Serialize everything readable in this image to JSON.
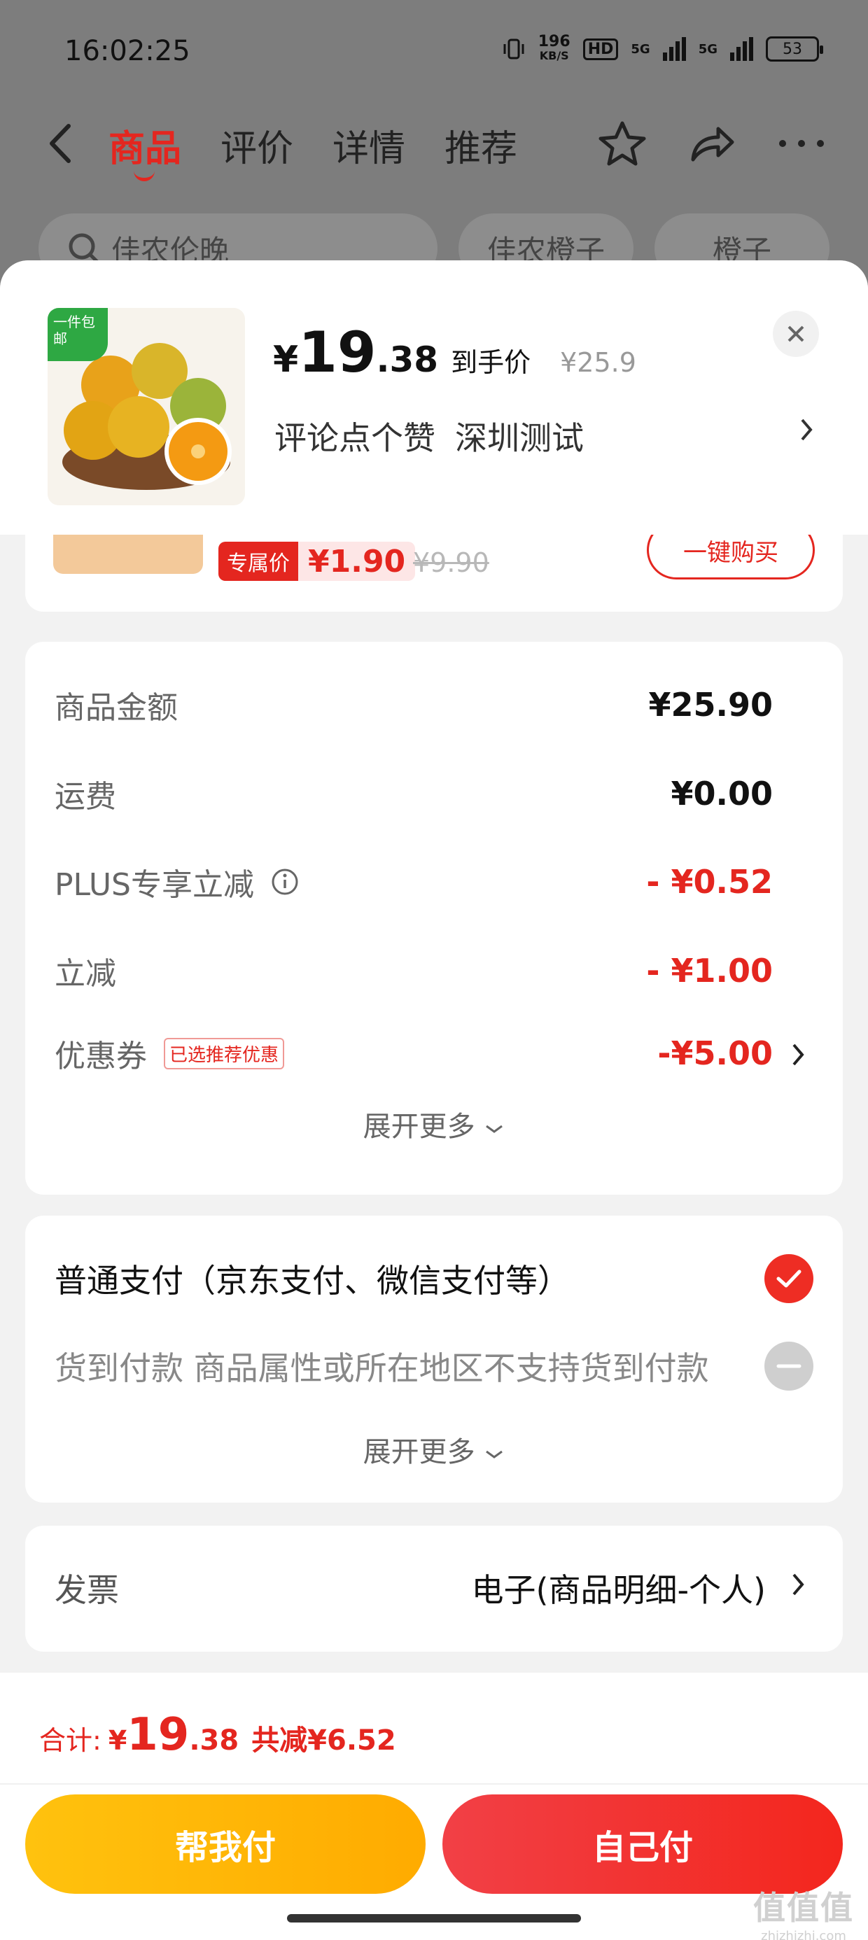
{
  "status_bar": {
    "time": "16:02:25",
    "net_speed_value": "196",
    "net_speed_unit": "KB/S",
    "hd": "HD",
    "sig1": "5G",
    "sig2": "5G",
    "battery": "53"
  },
  "nav": {
    "tabs": [
      "商品",
      "评价",
      "详情",
      "推荐"
    ],
    "active_tab": "商品",
    "icons": [
      "back-icon",
      "star-icon",
      "share-icon",
      "more-icon"
    ]
  },
  "background_search": {
    "search_text": "佳农伦晚",
    "chips": [
      "佳农橙子",
      "橙子"
    ]
  },
  "product": {
    "tag": "一件包邮",
    "price_currency": "¥",
    "price_int": "19",
    "price_dec": ".38",
    "price_label": "到手价",
    "original_price": "¥25.9",
    "spec_1": "评论点个赞",
    "spec_2": "深圳测试"
  },
  "upsell": {
    "badge": "专属价",
    "price": "¥1.90",
    "original": "¥9.90",
    "buy_label": "一键购买"
  },
  "fees": [
    {
      "label": "商品金额",
      "value": "¥25.90",
      "red": false
    },
    {
      "label": "运费",
      "value": "¥0.00",
      "red": false
    },
    {
      "label": "PLUS专享立减",
      "value": "- ¥0.52",
      "red": true
    },
    {
      "label": "立减",
      "value": "- ¥1.00",
      "red": true
    },
    {
      "label": "优惠券",
      "value": "-¥5.00",
      "red": true,
      "tag": "已选推荐优惠"
    }
  ],
  "fee_expand": "展开更多",
  "payment": {
    "options": [
      {
        "label": "普通支付（京东支付、微信支付等）",
        "selected": true
      },
      {
        "label": "货到付款 商品属性或所在地区不支持货到付款",
        "selected": false
      }
    ],
    "expand": "展开更多"
  },
  "invoice": {
    "label": "发票",
    "value": "电子(商品明细-个人)"
  },
  "footer": {
    "total_label": "合计:",
    "total_currency": "¥",
    "total_int": "19",
    "total_dec": ".38",
    "saving": "共减¥6.52",
    "help_pay": "帮我付",
    "self_pay": "自己付"
  },
  "watermark": {
    "big": "值值值",
    "small": "zhizhizhi.com"
  },
  "colors": {
    "accent_red": "#e4261f",
    "yellow_button": "#ffb700",
    "red_button": "#f3261d",
    "green_tag": "#2ea843"
  }
}
